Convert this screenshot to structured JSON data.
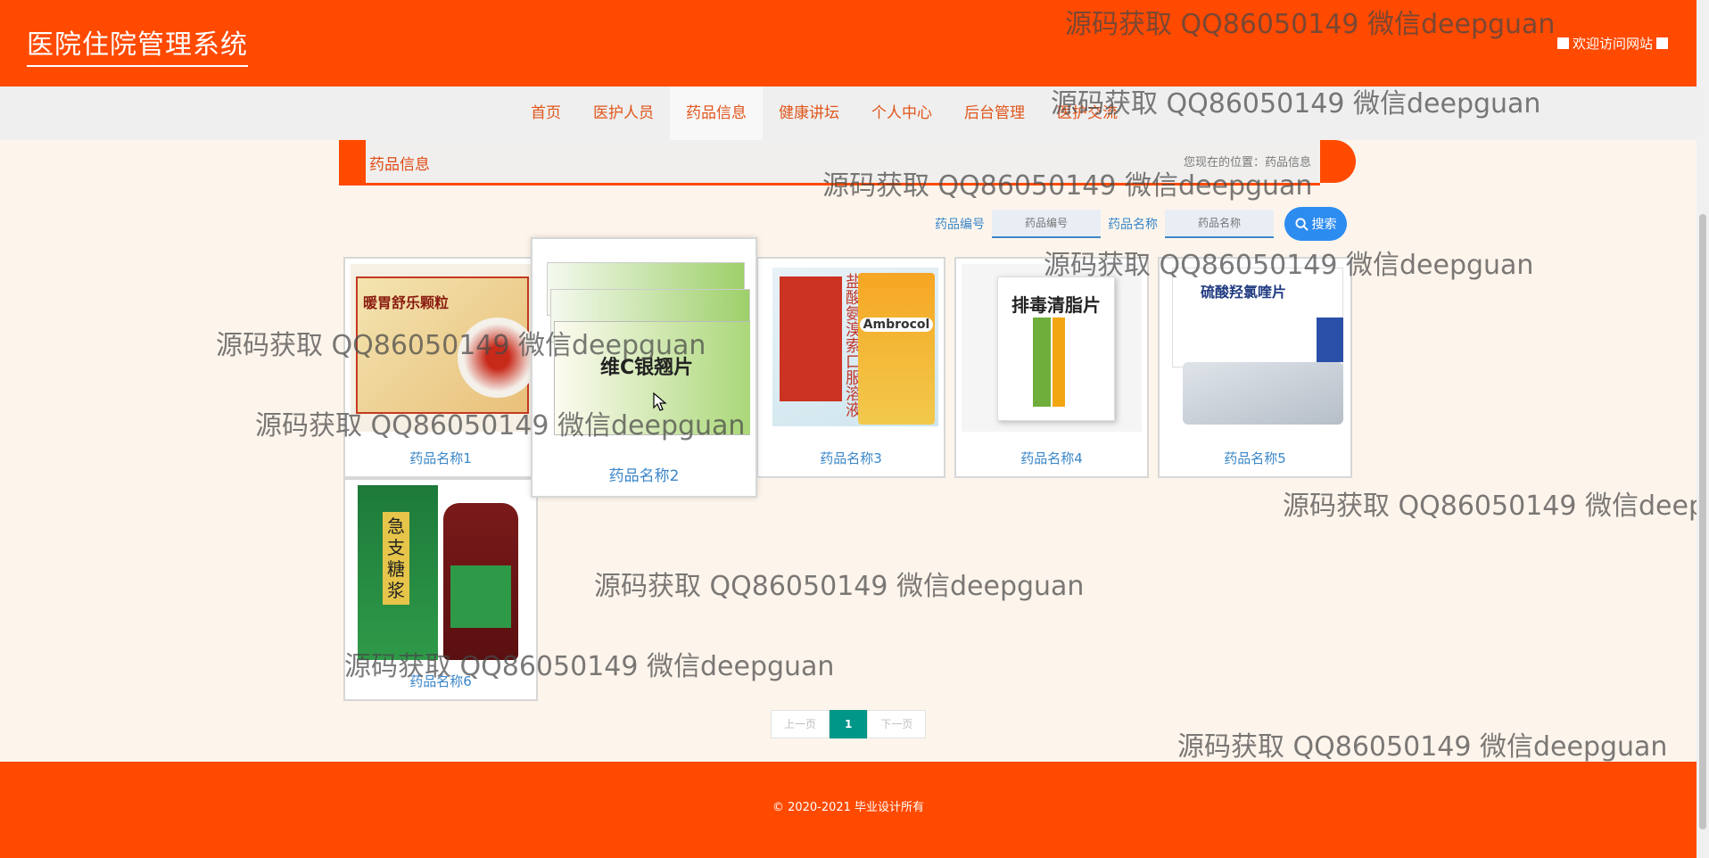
{
  "header": {
    "site_title": "医院住院管理系统",
    "welcome": "欢迎访问网站"
  },
  "nav": {
    "items": [
      "首页",
      "医护人员",
      "药品信息",
      "健康讲坛",
      "个人中心",
      "后台管理",
      "医护交流"
    ],
    "active": "药品信息"
  },
  "breadcrumb": {
    "title": "药品信息",
    "location": "您现在的位置：药品信息"
  },
  "search": {
    "code_label": "药品编号",
    "code_placeholder": "药品编号",
    "name_label": "药品名称",
    "name_placeholder": "药品名称",
    "button": "搜索"
  },
  "products": [
    {
      "name": "药品名称1",
      "pkg_text": "暖胃舒乐颗粒"
    },
    {
      "name": "药品名称2",
      "pkg_text": "维C银翘片"
    },
    {
      "name": "药品名称3",
      "pkg_text": "盐酸氨溴索口服溶液",
      "pkg_text2": "Ambrocol"
    },
    {
      "name": "药品名称4",
      "pkg_text": "排毒清脂片"
    },
    {
      "name": "药品名称5",
      "pkg_text": "硫酸羟氯喹片"
    },
    {
      "name": "药品名称6",
      "pkg_text": "急支糖浆"
    }
  ],
  "pagination": {
    "prev": "上一页",
    "current": "1",
    "next": "下一页"
  },
  "footer": {
    "copyright": "© 2020-2021 毕业设计所有"
  },
  "watermark": "源码获取 QQ86050149 微信deepguan",
  "colors": {
    "brand": "#ff4a00",
    "link": "#3a86c8",
    "page_active": "#009688"
  }
}
